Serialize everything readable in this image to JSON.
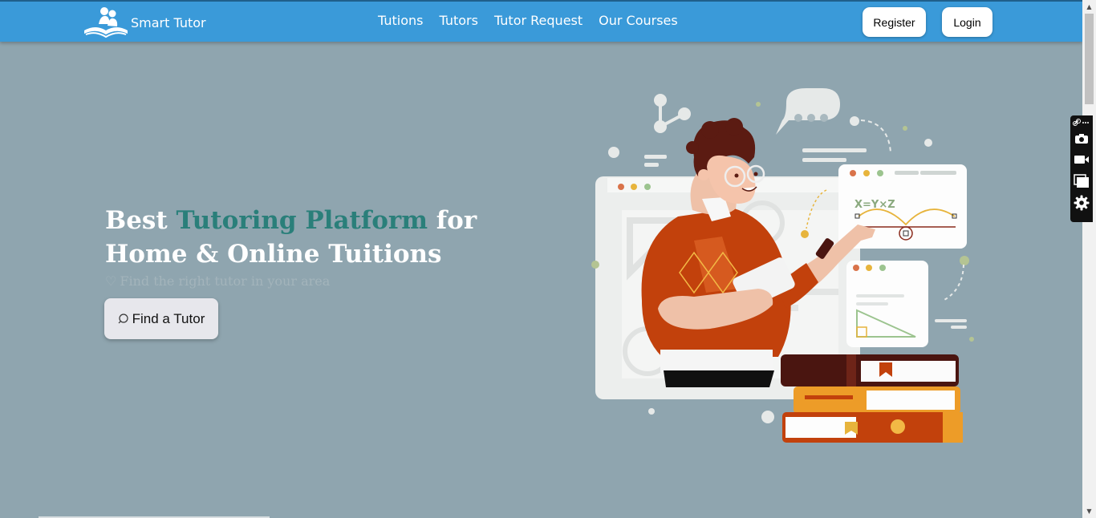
{
  "brand": {
    "name": "Smart Tutor",
    "logo_icon": "reading-books-logo-icon"
  },
  "nav": {
    "links": [
      "Tutions",
      "Tutors",
      "Tutor Request",
      "Our Courses"
    ],
    "register_label": "Register",
    "login_label": "Login"
  },
  "hero": {
    "title_part1": "Best ",
    "title_accent": "Tutoring Platform",
    "title_part2": " for Home & Online Tuitions",
    "subtitle": "Find the right tutor in your area",
    "subtitle_icon": "heart-icon",
    "cta_label": "Find a Tutor",
    "cta_icon": "search-icon"
  },
  "illustration": {
    "equation": "X=Y×Z"
  },
  "colors": {
    "navbar": "#3a9ad9",
    "background": "#8fa5af",
    "accent": "#2a7f7a",
    "white": "#ffffff"
  },
  "side_toolbar": {
    "icons": [
      "link-icon",
      "camera-icon",
      "video-icon",
      "windows-icon",
      "gear-icon"
    ]
  }
}
